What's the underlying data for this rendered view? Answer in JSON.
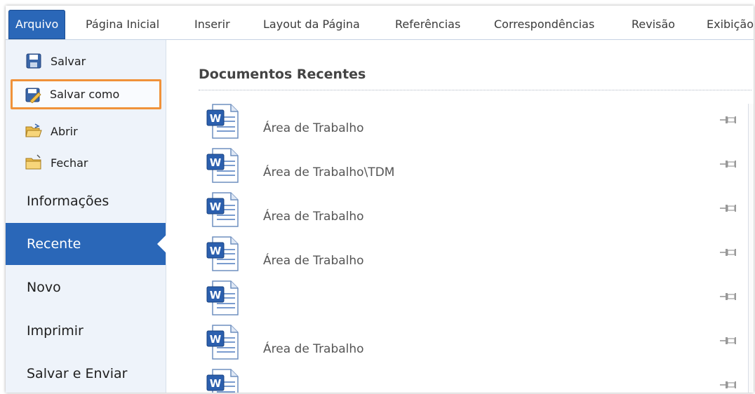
{
  "ribbon": {
    "tabs": [
      {
        "label": "Arquivo",
        "active": true
      },
      {
        "label": "Página Inicial"
      },
      {
        "label": "Inserir"
      },
      {
        "label": "Layout da Página"
      },
      {
        "label": "Referências"
      },
      {
        "label": "Correspondências"
      },
      {
        "label": "Revisão"
      },
      {
        "label": "Exibição"
      }
    ]
  },
  "nav": {
    "commands": [
      {
        "label": "Salvar",
        "icon": "save-icon"
      },
      {
        "label": "Salvar como",
        "icon": "save-as-icon",
        "highlighted": true,
        "highlight_color": "#f0923a"
      },
      {
        "label": "Abrir",
        "icon": "open-folder-icon"
      },
      {
        "label": "Fechar",
        "icon": "close-folder-icon"
      }
    ],
    "items": [
      {
        "label": "Informações"
      },
      {
        "label": "Recente",
        "selected": true
      },
      {
        "label": "Novo"
      },
      {
        "label": "Imprimir"
      },
      {
        "label": "Salvar e Enviar"
      }
    ],
    "selected_color": "#2a67b8"
  },
  "recent": {
    "title": "Documentos Recentes",
    "documents": [
      {
        "path": "Área de Trabalho",
        "icon": "word-document-icon"
      },
      {
        "path": "Área de Trabalho\\TDM",
        "icon": "word-document-icon"
      },
      {
        "path": "Área de Trabalho",
        "icon": "word-document-icon"
      },
      {
        "path": "Área de Trabalho",
        "icon": "word-document-icon"
      },
      {
        "path": "",
        "icon": "word-document-icon"
      },
      {
        "path": "Área de Trabalho",
        "icon": "word-document-icon"
      },
      {
        "path": "",
        "icon": "word-document-icon"
      }
    ]
  }
}
